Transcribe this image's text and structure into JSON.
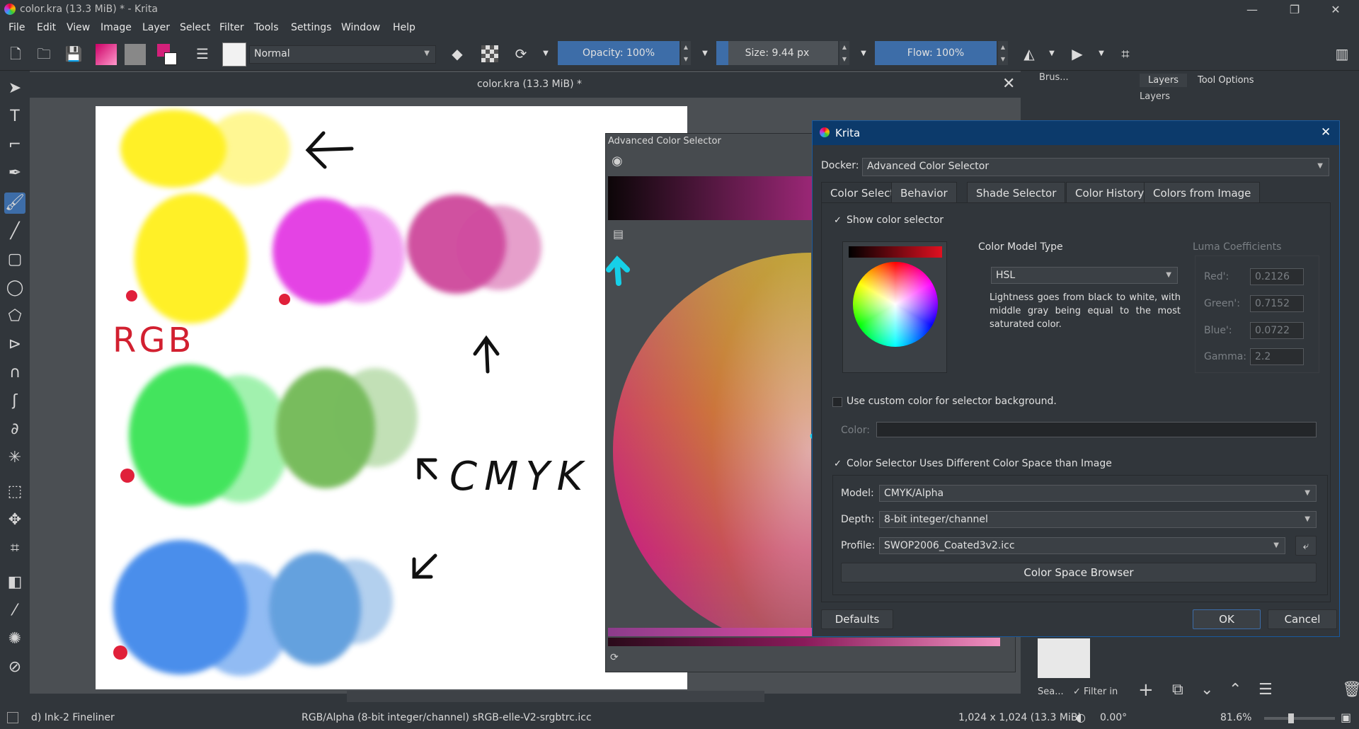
{
  "window": {
    "title": "color.kra (13.3 MiB) * - Krita",
    "minimize": "—",
    "maximize": "❐",
    "close": "✕"
  },
  "menu": [
    "File",
    "Edit",
    "View",
    "Image",
    "Layer",
    "Select",
    "Filter",
    "Tools",
    "Settings",
    "Window",
    "Help"
  ],
  "toolbar": {
    "blend_mode": "Normal",
    "opacity": "Opacity: 100%",
    "opacity_value": 1.0,
    "size": "Size: 9.44 px",
    "size_fill": 0.1,
    "flow": "Flow: 100%",
    "flow_value": 1.0,
    "fg_color": "#d4207a",
    "bg_color": "#ffffff"
  },
  "document": {
    "tab_title": "color.kra (13.3 MiB) *",
    "annotations": {
      "rgb": "RGB",
      "cmyk": "CMYK"
    }
  },
  "blobs": {
    "yellow": "#ffee00",
    "magenta": "#e020e0",
    "pink": "#c8308f",
    "green": "#20e040",
    "olive_green": "#60b040",
    "blue": "#2a7ae8",
    "steel_blue": "#4a90d8"
  },
  "acs": {
    "title": "Advanced Color Selector"
  },
  "dialog": {
    "title": "Krita",
    "docker_label": "Docker:",
    "docker_value": "Advanced Color Selector",
    "tabs": [
      "Color Selector",
      "Behavior",
      "Shade Selector",
      "Color History",
      "Colors from Image"
    ],
    "show_color_selector": "Show color selector",
    "color_model_type_label": "Color Model Type",
    "color_model_type": "HSL",
    "description": "Lightness goes from black to white, with middle gray being equal to the most saturated color.",
    "luma": {
      "heading": "Luma Coefficients",
      "red_label": "Red':",
      "red": "0.2126",
      "green_label": "Green':",
      "green": "0.7152",
      "blue_label": "Blue':",
      "blue": "0.0722",
      "gamma_label": "Gamma:",
      "gamma": "2.2"
    },
    "use_custom_color": "Use custom color for selector background.",
    "color_label": "Color:",
    "diff_space": "Color Selector Uses Different Color Space than Image",
    "model_label": "Model:",
    "model": "CMYK/Alpha",
    "depth_label": "Depth:",
    "depth": "8-bit integer/channel",
    "profile_label": "Profile:",
    "profile": "SWOP2006_Coated3v2.icc",
    "color_space_browser": "Color Space Browser",
    "defaults": "Defaults",
    "ok": "OK",
    "cancel": "Cancel"
  },
  "right_dock": {
    "brush_tab": "Brus...",
    "layers_tab": "Layers",
    "tool_options_tab": "Tool Options",
    "layers_title": "Layers",
    "search": "Sea...",
    "filter_in": "Filter in"
  },
  "status": {
    "brush": "d) Ink-2 Fineliner",
    "colorspace": "RGB/Alpha (8-bit integer/channel)  sRGB-elle-V2-srgbtrc.icc",
    "dimensions": "1,024 x 1,024 (13.3 MiB)",
    "rotation": "0.00°",
    "zoom": "81.6%"
  }
}
